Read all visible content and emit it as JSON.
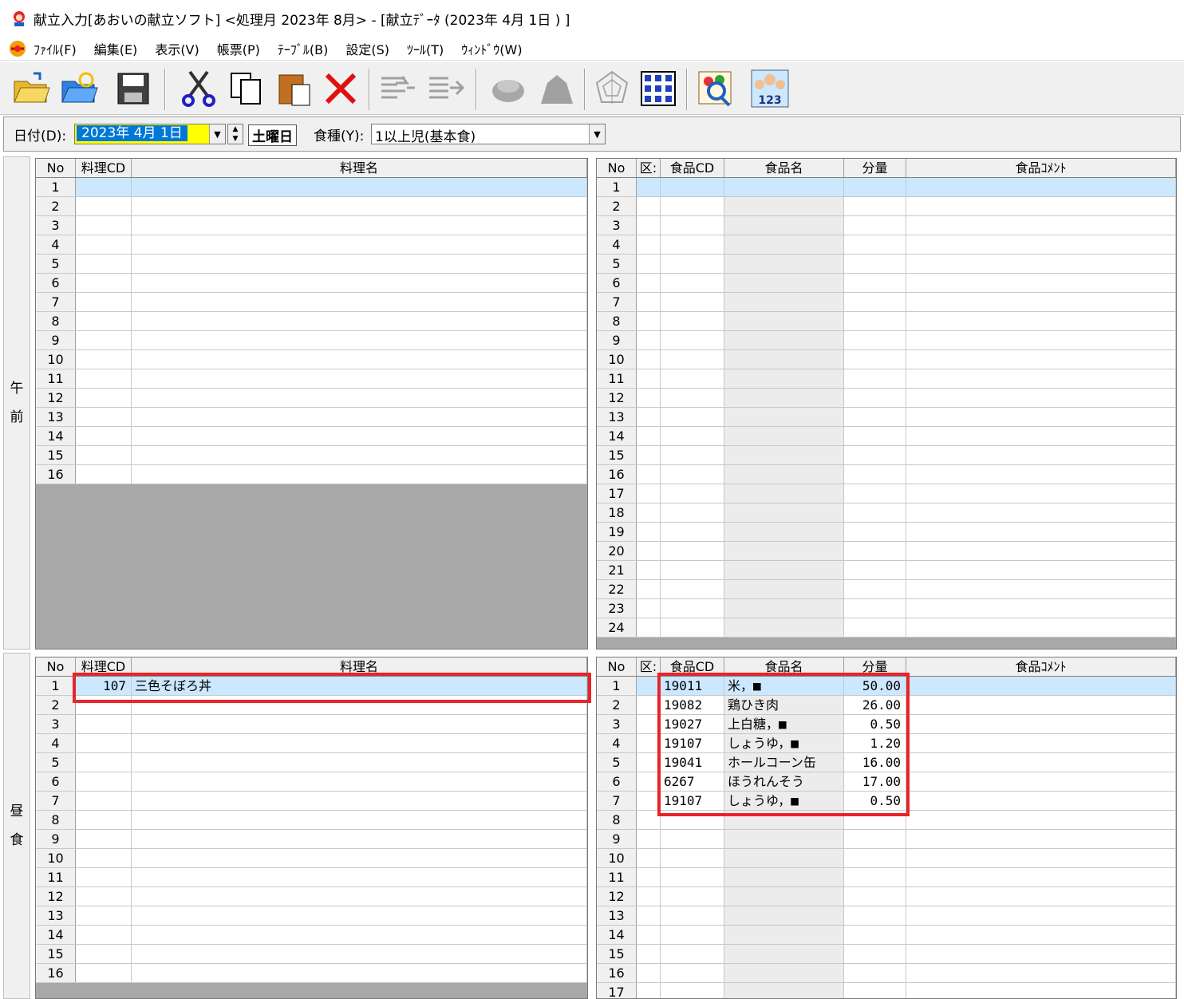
{
  "window": {
    "title": "献立入力[あおいの献立ソフト] <処理月 2023年 8月> - [献立ﾃﾞｰﾀ (2023年 4月 1日 ) ]"
  },
  "menu": [
    "ﾌｧｲﾙ(F)",
    "編集(E)",
    "表示(V)",
    "帳票(P)",
    "ﾃｰﾌﾞﾙ(B)",
    "設定(S)",
    "ﾂｰﾙ(T)",
    "ｳｨﾝﾄﾞｳ(W)"
  ],
  "toolbar": {
    "icons": [
      "open-folder-icon",
      "reload-folder-icon",
      "save-icon",
      "cut-icon",
      "copy-icon",
      "paste-icon",
      "delete-icon",
      "insert-row-icon",
      "append-row-icon",
      "nutrition-icon",
      "pot-icon",
      "chart-radar-icon",
      "grid-icon",
      "food-search-icon",
      "ranking-icon"
    ]
  },
  "filter": {
    "date_label": "日付(D):",
    "date_value": "2023年 4月 1日",
    "weekday": "土曜日",
    "type_label": "食種(Y):",
    "type_value": "1以上児(基本食)"
  },
  "dish_headers": [
    "No",
    "料理CD",
    "料理名"
  ],
  "food_headers": [
    "No",
    "区:",
    "食品CD",
    "食品名",
    "分量",
    "食品ｺﾒﾝﾄ"
  ],
  "sections": {
    "morning": {
      "label": [
        "午",
        "前"
      ],
      "dish_rows": [
        [
          "1",
          "",
          ""
        ],
        [
          "2",
          "",
          ""
        ],
        [
          "3",
          "",
          ""
        ],
        [
          "4",
          "",
          ""
        ],
        [
          "5",
          "",
          ""
        ],
        [
          "6",
          "",
          ""
        ],
        [
          "7",
          "",
          ""
        ],
        [
          "8",
          "",
          ""
        ],
        [
          "9",
          "",
          ""
        ],
        [
          "10",
          "",
          ""
        ],
        [
          "11",
          "",
          ""
        ],
        [
          "12",
          "",
          ""
        ],
        [
          "13",
          "",
          ""
        ],
        [
          "14",
          "",
          ""
        ],
        [
          "15",
          "",
          ""
        ],
        [
          "16",
          "",
          ""
        ]
      ],
      "food_rows": [
        [
          "1",
          "",
          "",
          "",
          "",
          ""
        ],
        [
          "2",
          "",
          "",
          "",
          "",
          ""
        ],
        [
          "3",
          "",
          "",
          "",
          "",
          ""
        ],
        [
          "4",
          "",
          "",
          "",
          "",
          ""
        ],
        [
          "5",
          "",
          "",
          "",
          "",
          ""
        ],
        [
          "6",
          "",
          "",
          "",
          "",
          ""
        ],
        [
          "7",
          "",
          "",
          "",
          "",
          ""
        ],
        [
          "8",
          "",
          "",
          "",
          "",
          ""
        ],
        [
          "9",
          "",
          "",
          "",
          "",
          ""
        ],
        [
          "10",
          "",
          "",
          "",
          "",
          ""
        ],
        [
          "11",
          "",
          "",
          "",
          "",
          ""
        ],
        [
          "12",
          "",
          "",
          "",
          "",
          ""
        ],
        [
          "13",
          "",
          "",
          "",
          "",
          ""
        ],
        [
          "14",
          "",
          "",
          "",
          "",
          ""
        ],
        [
          "15",
          "",
          "",
          "",
          "",
          ""
        ],
        [
          "16",
          "",
          "",
          "",
          "",
          ""
        ],
        [
          "17",
          "",
          "",
          "",
          "",
          ""
        ],
        [
          "18",
          "",
          "",
          "",
          "",
          ""
        ],
        [
          "19",
          "",
          "",
          "",
          "",
          ""
        ],
        [
          "20",
          "",
          "",
          "",
          "",
          ""
        ],
        [
          "21",
          "",
          "",
          "",
          "",
          ""
        ],
        [
          "22",
          "",
          "",
          "",
          "",
          ""
        ],
        [
          "23",
          "",
          "",
          "",
          "",
          ""
        ],
        [
          "24",
          "",
          "",
          "",
          "",
          ""
        ]
      ]
    },
    "lunch": {
      "label": [
        "昼",
        "食"
      ],
      "dish_rows": [
        [
          "1",
          "107",
          "三色そぼろ丼"
        ],
        [
          "2",
          "",
          ""
        ],
        [
          "3",
          "",
          ""
        ],
        [
          "4",
          "",
          ""
        ],
        [
          "5",
          "",
          ""
        ],
        [
          "6",
          "",
          ""
        ],
        [
          "7",
          "",
          ""
        ],
        [
          "8",
          "",
          ""
        ],
        [
          "9",
          "",
          ""
        ],
        [
          "10",
          "",
          ""
        ],
        [
          "11",
          "",
          ""
        ],
        [
          "12",
          "",
          ""
        ],
        [
          "13",
          "",
          ""
        ],
        [
          "14",
          "",
          ""
        ],
        [
          "15",
          "",
          ""
        ],
        [
          "16",
          "",
          ""
        ]
      ],
      "food_rows": [
        [
          "1",
          "",
          "19011",
          "米，■",
          "50.00",
          ""
        ],
        [
          "2",
          "",
          "19082",
          "鶏ひき肉",
          "26.00",
          ""
        ],
        [
          "3",
          "",
          "19027",
          "上白糖，■",
          "0.50",
          ""
        ],
        [
          "4",
          "",
          "19107",
          "しょうゆ，■",
          "1.20",
          ""
        ],
        [
          "5",
          "",
          "19041",
          "ホールコーン缶",
          "16.00",
          ""
        ],
        [
          "6",
          "",
          "6267",
          "ほうれんそう",
          "17.00",
          ""
        ],
        [
          "7",
          "",
          "19107",
          "しょうゆ，■",
          "0.50",
          ""
        ],
        [
          "8",
          "",
          "",
          "",
          "",
          ""
        ],
        [
          "9",
          "",
          "",
          "",
          "",
          ""
        ],
        [
          "10",
          "",
          "",
          "",
          "",
          ""
        ],
        [
          "11",
          "",
          "",
          "",
          "",
          ""
        ],
        [
          "12",
          "",
          "",
          "",
          "",
          ""
        ],
        [
          "13",
          "",
          "",
          "",
          "",
          ""
        ],
        [
          "14",
          "",
          "",
          "",
          "",
          ""
        ],
        [
          "15",
          "",
          "",
          "",
          "",
          ""
        ],
        [
          "16",
          "",
          "",
          "",
          "",
          ""
        ],
        [
          "17",
          "",
          "",
          "",
          "",
          ""
        ]
      ]
    }
  },
  "colors": {
    "highlight": "#e8232a",
    "selection": "#cce8ff",
    "date_bg": "#ffff00"
  }
}
